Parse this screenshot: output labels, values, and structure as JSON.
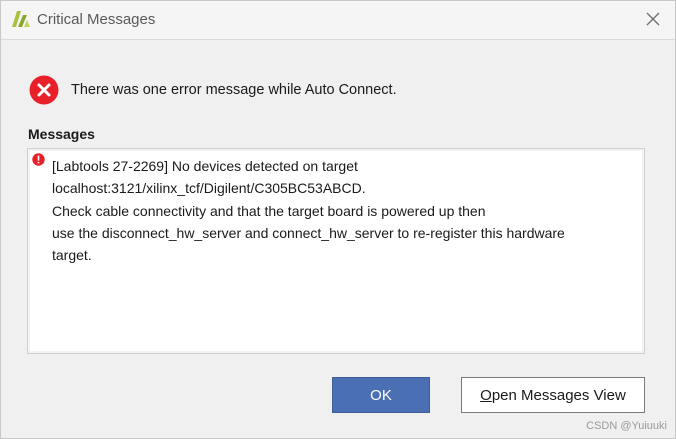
{
  "window": {
    "title": "Critical Messages"
  },
  "header": {
    "text": "There was one error message while Auto Connect."
  },
  "messages": {
    "label": "Messages",
    "lines": [
      "[Labtools 27-2269] No devices detected on target",
      "localhost:3121/xilinx_tcf/Digilent/C305BC53ABCD.",
      "Check cable connectivity and that the target board is powered up then",
      "use the disconnect_hw_server and connect_hw_server to re-register this hardware",
      "target."
    ]
  },
  "buttons": {
    "ok_label": "OK",
    "open_mnemonic": "O",
    "open_rest": "pen Messages View"
  },
  "watermark": "CSDN @Yuiuuki",
  "colors": {
    "error_red": "#e8202a",
    "ok_button": "#4a6fb2",
    "logo_green": "#a9c23f"
  }
}
